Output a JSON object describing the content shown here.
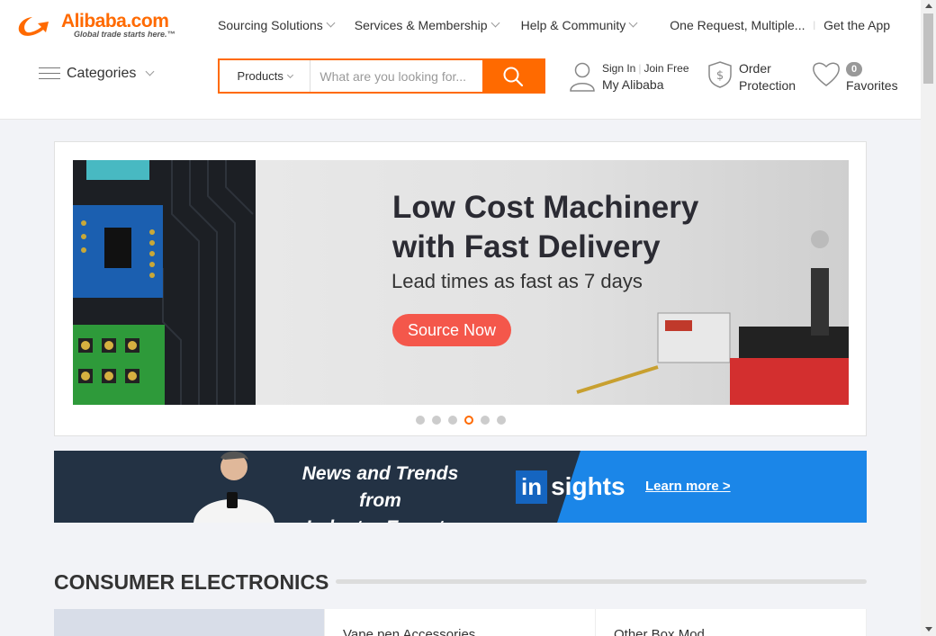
{
  "logo": {
    "word": "Alibaba.com",
    "tagline": "Global trade starts here.™"
  },
  "topnav": {
    "items": [
      {
        "label": "Sourcing Solutions"
      },
      {
        "label": "Services & Membership"
      },
      {
        "label": "Help & Community"
      },
      {
        "label": "One Request, Multiple..."
      },
      {
        "label": "Get the App"
      }
    ]
  },
  "categories": {
    "label": "Categories"
  },
  "search": {
    "scope": "Products",
    "placeholder": "What are you looking for..."
  },
  "account": {
    "sign_in": "Sign In",
    "join": "Join Free",
    "my": "My Alibaba"
  },
  "order": {
    "line1": "Order",
    "line2": "Protection"
  },
  "favorites": {
    "count": "0",
    "label": "Favorites"
  },
  "banner": {
    "title_line1": "Low Cost Machinery",
    "title_line2": "with Fast Delivery",
    "subtitle": "Lead times as fast as 7 days",
    "cta": "Source Now",
    "active_slide": 4,
    "slide_count": 6
  },
  "insights": {
    "title_line1": "News and Trends from",
    "title_line2": "Industry Experts",
    "logo_in": "in",
    "logo_sights": "sights",
    "cta": "Learn more >"
  },
  "section": {
    "title": "CONSUMER ELECTRONICS",
    "cards": [
      "Vape pen Accessories",
      "Other Box Mod"
    ]
  },
  "colors": {
    "accent": "#ff6a00",
    "cta": "#f4574b",
    "insights_blue": "#1b86e8"
  }
}
